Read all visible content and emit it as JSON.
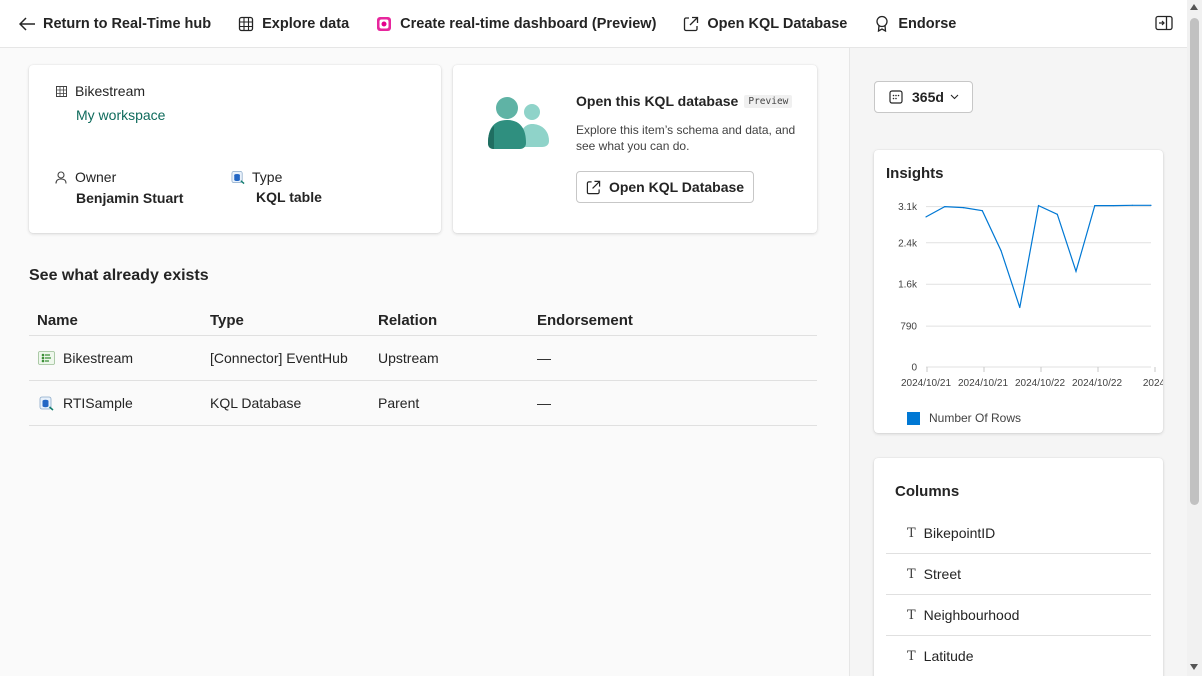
{
  "toolbar": {
    "return_label": "Return to Real-Time hub",
    "explore_label": "Explore data",
    "dashboard_label": "Create real-time dashboard (Preview)",
    "open_kql_label": "Open KQL Database",
    "endorse_label": "Endorse"
  },
  "info": {
    "item_name": "Bikestream",
    "workspace": "My workspace",
    "owner_label": "Owner",
    "owner_value": "Benjamin Stuart",
    "type_label": "Type",
    "type_value": "KQL table"
  },
  "open_card": {
    "title": "Open this KQL database",
    "badge": "Preview",
    "description": "Explore this item’s schema and data, and see what you can do.",
    "button_label": "Open KQL Database"
  },
  "existing": {
    "title": "See what already exists",
    "headers": [
      "Name",
      "Type",
      "Relation",
      "Endorsement"
    ],
    "rows": [
      {
        "name": "Bikestream",
        "type": "[Connector] EventHub",
        "relation": "Upstream",
        "endorsement": "—"
      },
      {
        "name": "RTISample",
        "type": "KQL Database",
        "relation": "Parent",
        "endorsement": "—"
      }
    ]
  },
  "time_range": {
    "label": "365d"
  },
  "insights": {
    "title": "Insights",
    "legend": "Number Of Rows",
    "legend_color": "#0078d4"
  },
  "chart_data": {
    "type": "line",
    "title": "Insights",
    "y_ticks": [
      "0",
      "790",
      "1.6k",
      "2.4k",
      "3.1k"
    ],
    "ylim": [
      0,
      3150
    ],
    "x_ticks": [
      "2024/10/21",
      "2024/10/21",
      "2024/10/22",
      "2024/10/22",
      "2024"
    ],
    "series": [
      {
        "name": "Number Of Rows",
        "color": "#0078d4",
        "values": [
          2900,
          3100,
          3080,
          3020,
          2250,
          1150,
          3120,
          2950,
          1850,
          3120,
          3120,
          3125,
          3125
        ]
      }
    ],
    "grid": true,
    "legend_position": "bottom-left"
  },
  "columns": {
    "title": "Columns",
    "items": [
      "BikepointID",
      "Street",
      "Neighbourhood",
      "Latitude"
    ]
  }
}
